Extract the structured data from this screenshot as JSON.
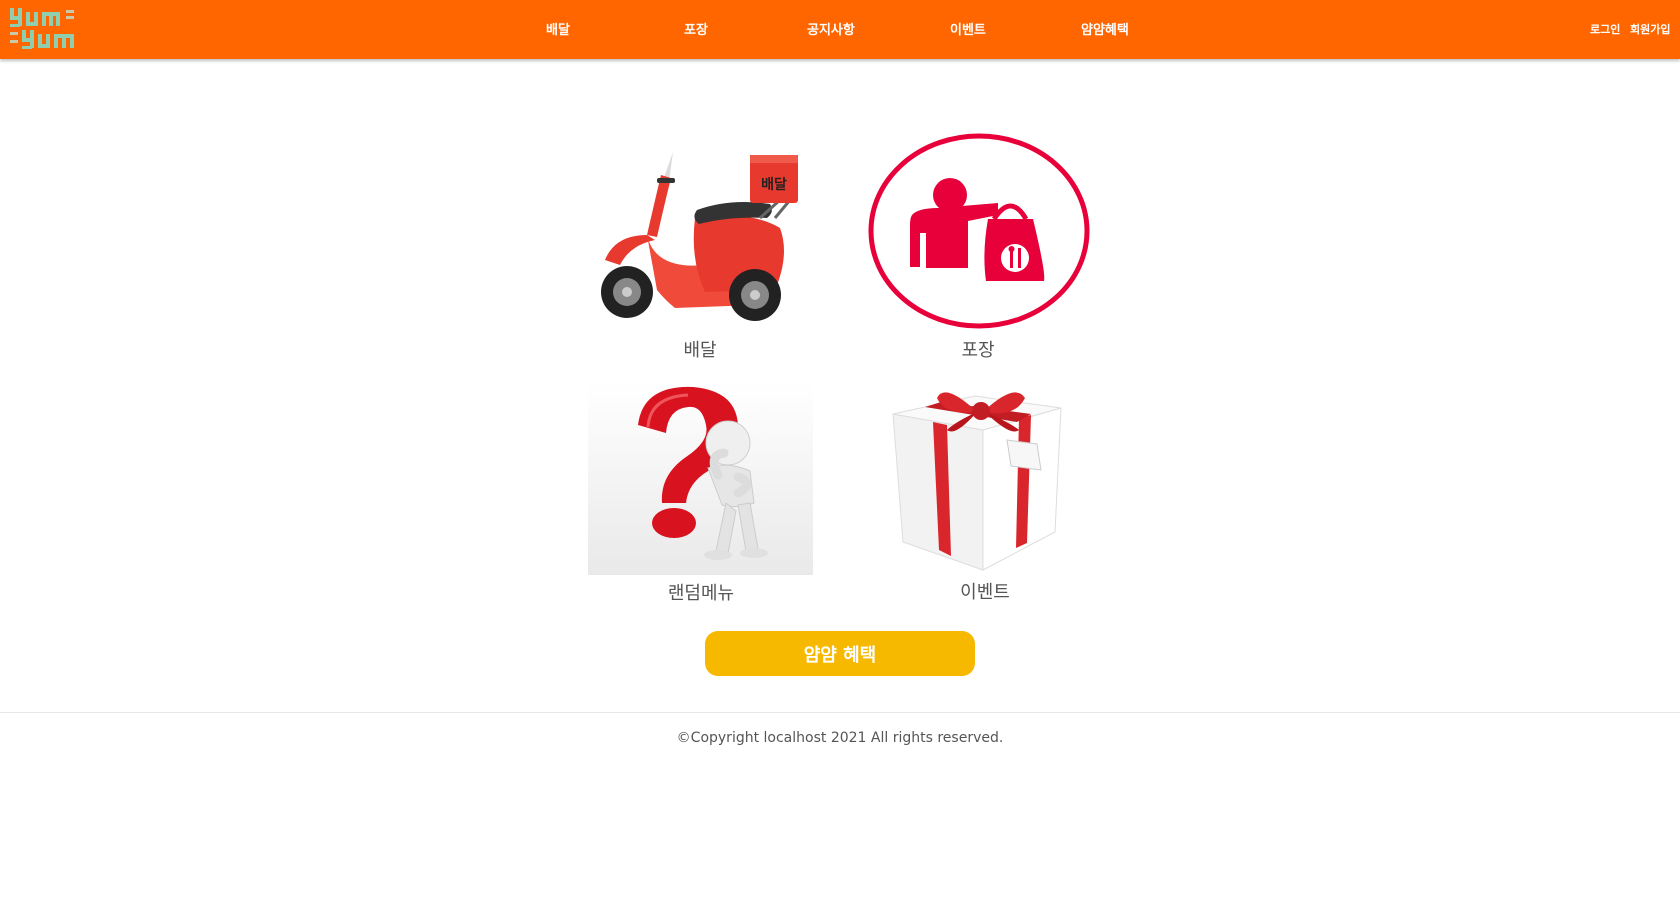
{
  "header": {
    "logo_text": "yum yum",
    "nav": [
      "배달",
      "포장",
      "공지사항",
      "이벤트",
      "얌얌혜택"
    ],
    "login": "로그인",
    "signup": "회원가입"
  },
  "tiles": [
    {
      "label": "배달",
      "icon": "scooter-icon",
      "box_text": "배달"
    },
    {
      "label": "포장",
      "icon": "takeout-icon"
    },
    {
      "label": "랜덤메뉴",
      "icon": "question-icon"
    },
    {
      "label": "이벤트",
      "icon": "gift-icon"
    }
  ],
  "benefit_button": "얌얌 혜택",
  "footer": "©Copyright localhost 2021 All rights reserved.",
  "colors": {
    "header": "#ff6600",
    "button": "#f7b800",
    "takeout": "#e8003a",
    "scooter": "#e8392f",
    "logo": "#8fcfb0"
  }
}
